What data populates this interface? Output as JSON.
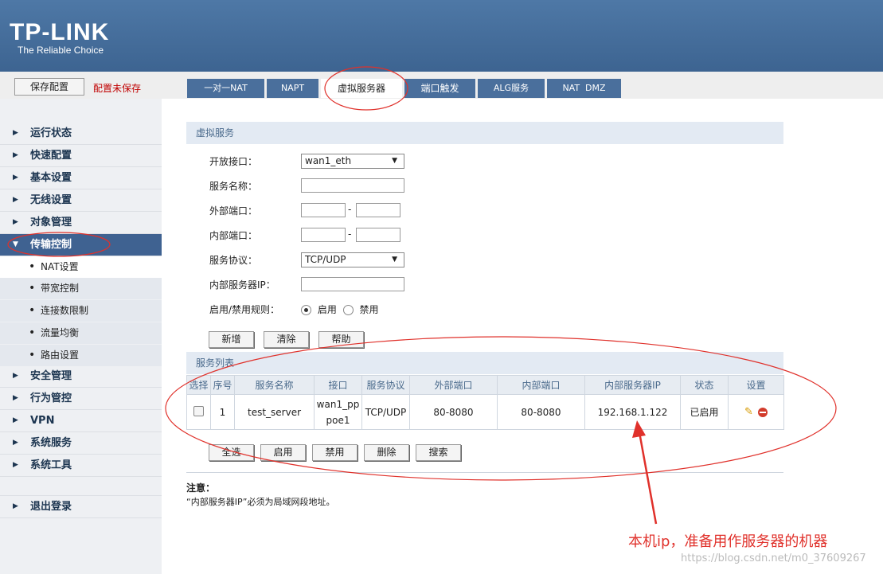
{
  "header": {
    "logo": "TP-LINK",
    "slogan": "The Reliable Choice"
  },
  "toolbar": {
    "save_label": "保存配置",
    "unsaved_text": "配置未保存"
  },
  "tabs": [
    {
      "label": "一对一NAT"
    },
    {
      "label": "NAPT"
    },
    {
      "label": "虚拟服务器"
    },
    {
      "label": "端口触发"
    },
    {
      "label": "ALG服务"
    },
    {
      "label": "NAT  DMZ"
    }
  ],
  "sidebar": {
    "items": [
      {
        "label": "运行状态"
      },
      {
        "label": "快速配置"
      },
      {
        "label": "基本设置"
      },
      {
        "label": "无线设置"
      },
      {
        "label": "对象管理"
      },
      {
        "label": "传输控制"
      },
      {
        "label": "安全管理"
      },
      {
        "label": "行为管控"
      },
      {
        "label": "VPN"
      },
      {
        "label": "系统服务"
      },
      {
        "label": "系统工具"
      },
      {
        "label": "退出登录"
      }
    ],
    "subitems": [
      {
        "label": "NAT设置"
      },
      {
        "label": "带宽控制"
      },
      {
        "label": "连接数限制"
      },
      {
        "label": "流量均衡"
      },
      {
        "label": "路由设置"
      }
    ]
  },
  "form": {
    "section_title": "虚拟服务",
    "interface_label": "开放接口：",
    "interface_value": "wan1_eth",
    "name_label": "服务名称：",
    "ext_port_label": "外部端口：",
    "int_port_label": "内部端口：",
    "port_sep": "-",
    "protocol_label": "服务协议：",
    "protocol_value": "TCP/UDP",
    "server_ip_label": "内部服务器IP：",
    "enable_label": "启用/禁用规则：",
    "enable_option": "启用",
    "disable_option": "禁用",
    "buttons": {
      "add": "新增",
      "clear": "清除",
      "help": "帮助"
    }
  },
  "list": {
    "section_title": "服务列表",
    "columns": [
      "选择",
      "序号",
      "服务名称",
      "接口",
      "服务协议",
      "外部端口",
      "内部端口",
      "内部服务器IP",
      "状态",
      "设置"
    ],
    "rows": [
      {
        "index": "1",
        "name": "test_server",
        "interface": "wan1_pppoe1",
        "protocol": "TCP/UDP",
        "ext_port": "80-8080",
        "int_port": "80-8080",
        "server_ip": "192.168.1.122",
        "status": "已启用"
      }
    ],
    "buttons": {
      "select_all": "全选",
      "enable": "启用",
      "disable": "禁用",
      "delete": "删除",
      "search": "搜索"
    }
  },
  "note": {
    "title": "注意：",
    "text": "“内部服务器IP”必须为局域网段地址。"
  },
  "annotation": {
    "text": "本机ip，准备用作服务器的机器",
    "color": "#e0312b"
  },
  "watermark": "https://blog.csdn.net/m0_37609267"
}
